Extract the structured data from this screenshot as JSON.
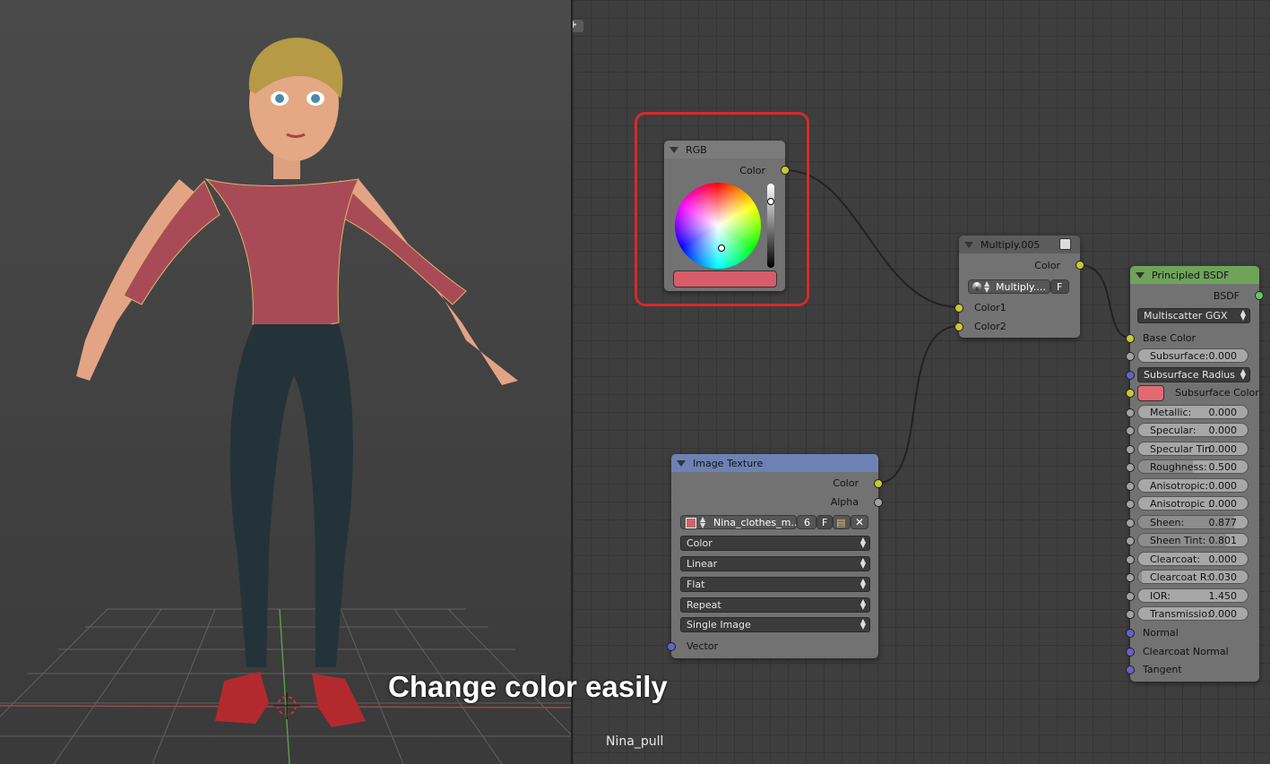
{
  "caption": "Change color easily",
  "object_name": "Nina_pull",
  "colors": {
    "shirt": "#a84b57",
    "rgb_swatch": "#d95c6a",
    "subsurface_swatch": "#e26a72",
    "highlight_box": "#d42b2b"
  },
  "rgb_node": {
    "title": "RGB",
    "output": "Color"
  },
  "multiply_node": {
    "title": "Multiply.005",
    "output": "Color",
    "mode": "Multiply....",
    "clamp_label": "F",
    "inputs": [
      "Color1",
      "Color2"
    ]
  },
  "image_node": {
    "title": "Image Texture",
    "outputs": [
      "Color",
      "Alpha"
    ],
    "image_name": "Nina_clothes_m...",
    "users": "6",
    "fake_label": "F",
    "dropdowns": [
      "Color",
      "Linear",
      "Flat",
      "Repeat",
      "Single Image"
    ],
    "input": "Vector"
  },
  "bsdf_node": {
    "title": "Principled BSDF",
    "output": "BSDF",
    "distribution": "Multiscatter GGX",
    "base_color": "Base Color",
    "subsurface_radius": "Subsurface Radius",
    "subsurface_color": "Subsurface Color",
    "sliders": [
      {
        "label": "Subsurface:",
        "value": "0.000",
        "frac": 0.0
      },
      {
        "label": "Metallic:",
        "value": "0.000",
        "frac": 0.0
      },
      {
        "label": "Specular:",
        "value": "0.000",
        "frac": 0.0
      },
      {
        "label": "Specular Tin",
        "value": "0.000",
        "frac": 0.0
      },
      {
        "label": "Roughness:",
        "value": "0.500",
        "frac": 0.5
      },
      {
        "label": "Anisotropic:",
        "value": "0.000",
        "frac": 0.0
      },
      {
        "label": "Anisotropic :",
        "value": "0.000",
        "frac": 0.0
      },
      {
        "label": "Sheen:",
        "value": "0.877",
        "frac": 0.877
      },
      {
        "label": "Sheen Tint:",
        "value": "0.801",
        "frac": 0.801
      },
      {
        "label": "Clearcoat:",
        "value": "0.000",
        "frac": 0.0
      },
      {
        "label": "Clearcoat R:",
        "value": "0.030",
        "frac": 0.03
      },
      {
        "label": "IOR:",
        "value": "1.450",
        "frac": 0.0
      },
      {
        "label": "Transmissio:",
        "value": "0.000",
        "frac": 0.0
      }
    ],
    "vector_inputs": [
      "Normal",
      "Clearcoat Normal",
      "Tangent"
    ]
  }
}
